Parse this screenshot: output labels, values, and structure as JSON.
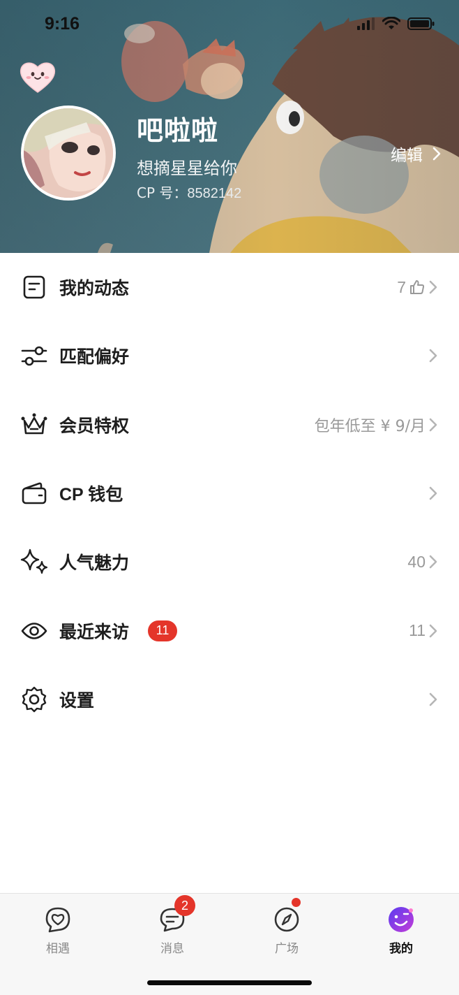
{
  "status_bar": {
    "time": "9:16"
  },
  "profile": {
    "name": "吧啦啦",
    "bio": "想摘星星给你",
    "id_label": "CP 号：",
    "id_value": "8582142",
    "edit_label": "编辑"
  },
  "menu": {
    "items": [
      {
        "label": "我的动态",
        "icon": "post-icon",
        "right_text": "7",
        "right_icon": "thumbs-up-icon"
      },
      {
        "label": "匹配偏好",
        "icon": "sliders-icon",
        "right_text": ""
      },
      {
        "label": "会员特权",
        "icon": "crown-icon",
        "right_text": "包年低至 ¥ 9/月"
      },
      {
        "label": "CP 钱包",
        "icon": "wallet-icon",
        "right_text": ""
      },
      {
        "label": "人气魅力",
        "icon": "sparkle-icon",
        "right_text": "40"
      },
      {
        "label": "最近来访",
        "icon": "eye-icon",
        "badge": "11",
        "right_text": "11"
      },
      {
        "label": "设置",
        "icon": "gear-icon",
        "right_text": ""
      }
    ]
  },
  "tabbar": {
    "tabs": [
      {
        "label": "相遇",
        "icon": "heart-chat-icon",
        "active": false
      },
      {
        "label": "消息",
        "icon": "message-icon",
        "badge": "2",
        "active": false
      },
      {
        "label": "广场",
        "icon": "compass-icon",
        "dot": true,
        "active": false
      },
      {
        "label": "我的",
        "icon": "profile-face-icon",
        "active": true
      }
    ]
  },
  "colors": {
    "header_bg": "#47727d",
    "badge_red": "#e4352a",
    "text_primary": "#1e1e1e",
    "text_secondary": "#999999",
    "active_icon_gradient": [
      "#5b3cf0",
      "#c23cd8"
    ]
  }
}
